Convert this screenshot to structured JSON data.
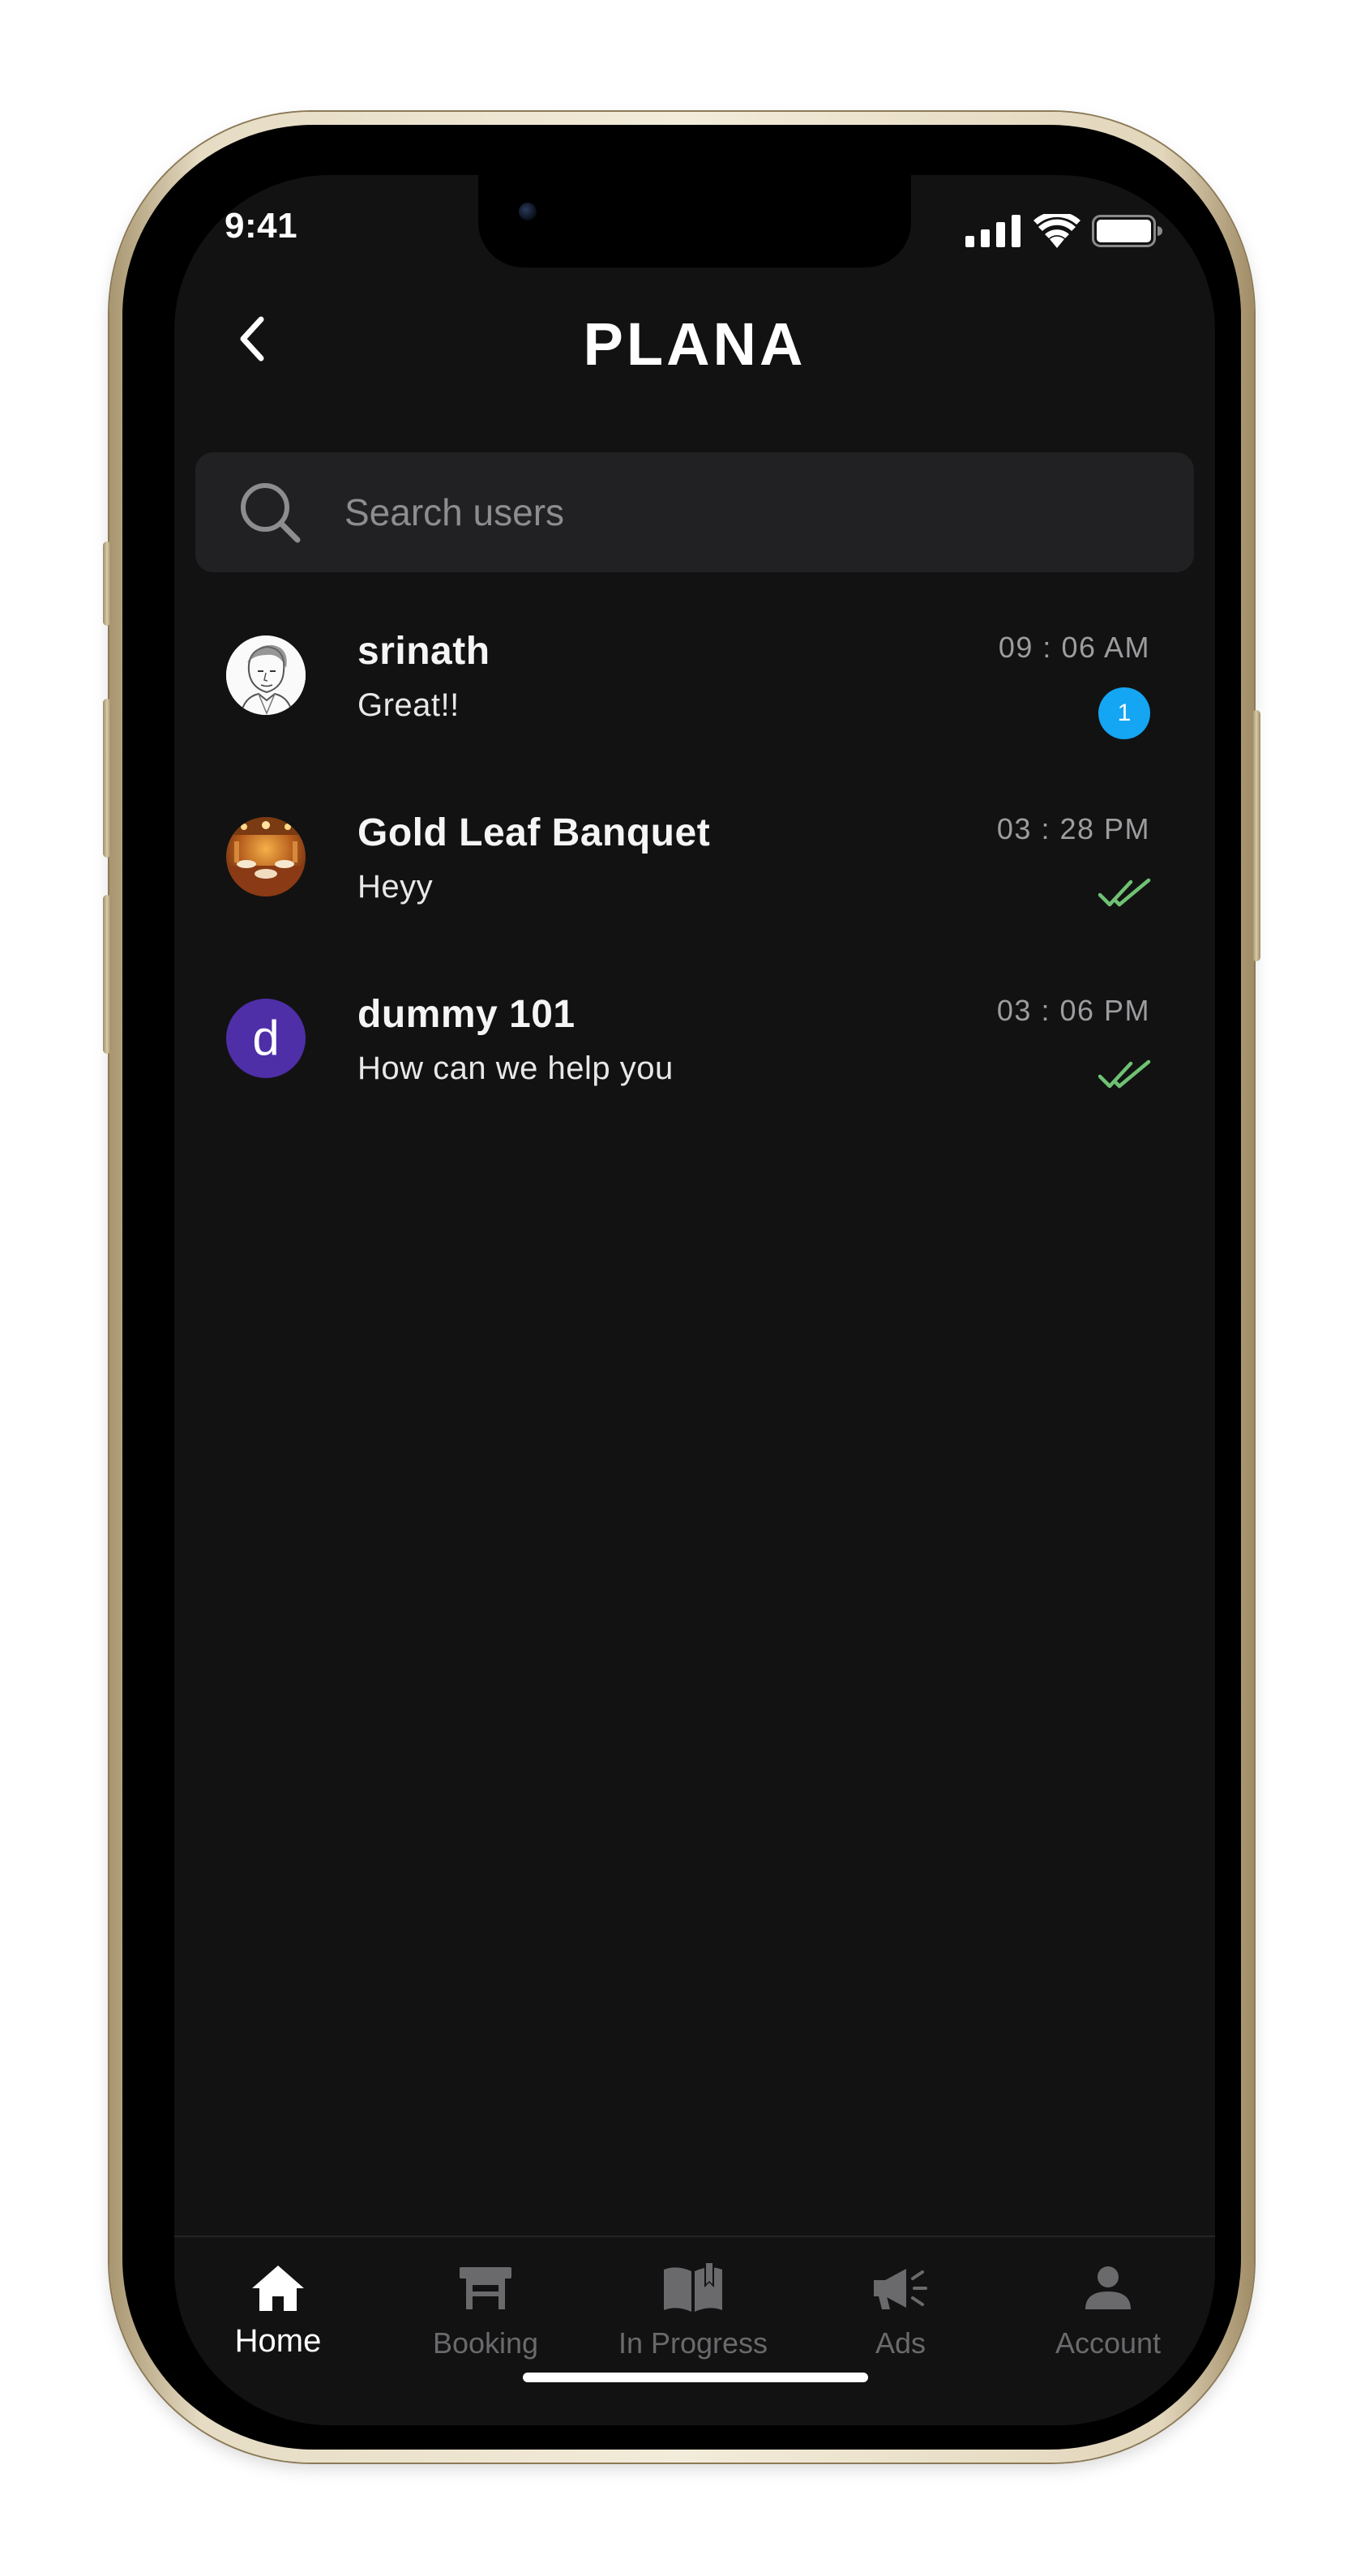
{
  "status_bar": {
    "time": "9:41",
    "signal_icon": "cellular-signal-icon",
    "wifi_icon": "wifi-icon",
    "battery_icon": "battery-icon"
  },
  "header": {
    "back_icon": "chevron-left-icon",
    "logo": "PLANA"
  },
  "search": {
    "icon": "search-icon",
    "placeholder": "Search users",
    "value": ""
  },
  "chats": [
    {
      "name": "srinath",
      "message": "Great!!",
      "time": "09 : 06 AM",
      "unread": "1",
      "avatar": "sketch-portrait-avatar"
    },
    {
      "name": "Gold Leaf Banquet",
      "message": "Heyy",
      "time": "03 : 28 PM",
      "status_icon": "double-check-icon",
      "avatar": "banquet-hall-photo-avatar"
    },
    {
      "name": "dummy 101",
      "message": "How can we help you",
      "time": "03 : 06 PM",
      "status_icon": "double-check-icon",
      "avatar_letter": "d",
      "avatar_color": "#4e2fa8"
    }
  ],
  "tabs": [
    {
      "label": "Home",
      "icon": "home-icon",
      "active": true
    },
    {
      "label": "Booking",
      "icon": "table-icon",
      "active": false
    },
    {
      "label": "In Progress",
      "icon": "open-book-icon",
      "active": false
    },
    {
      "label": "Ads",
      "icon": "megaphone-icon",
      "active": false
    },
    {
      "label": "Account",
      "icon": "person-icon",
      "active": false
    }
  ],
  "colors": {
    "background": "#121212",
    "search_bg": "#212123",
    "unread_badge": "#14a6f2",
    "read_ticks": "#6fc274",
    "tab_inactive": "#6a6a6d",
    "tab_active": "#ffffff"
  }
}
